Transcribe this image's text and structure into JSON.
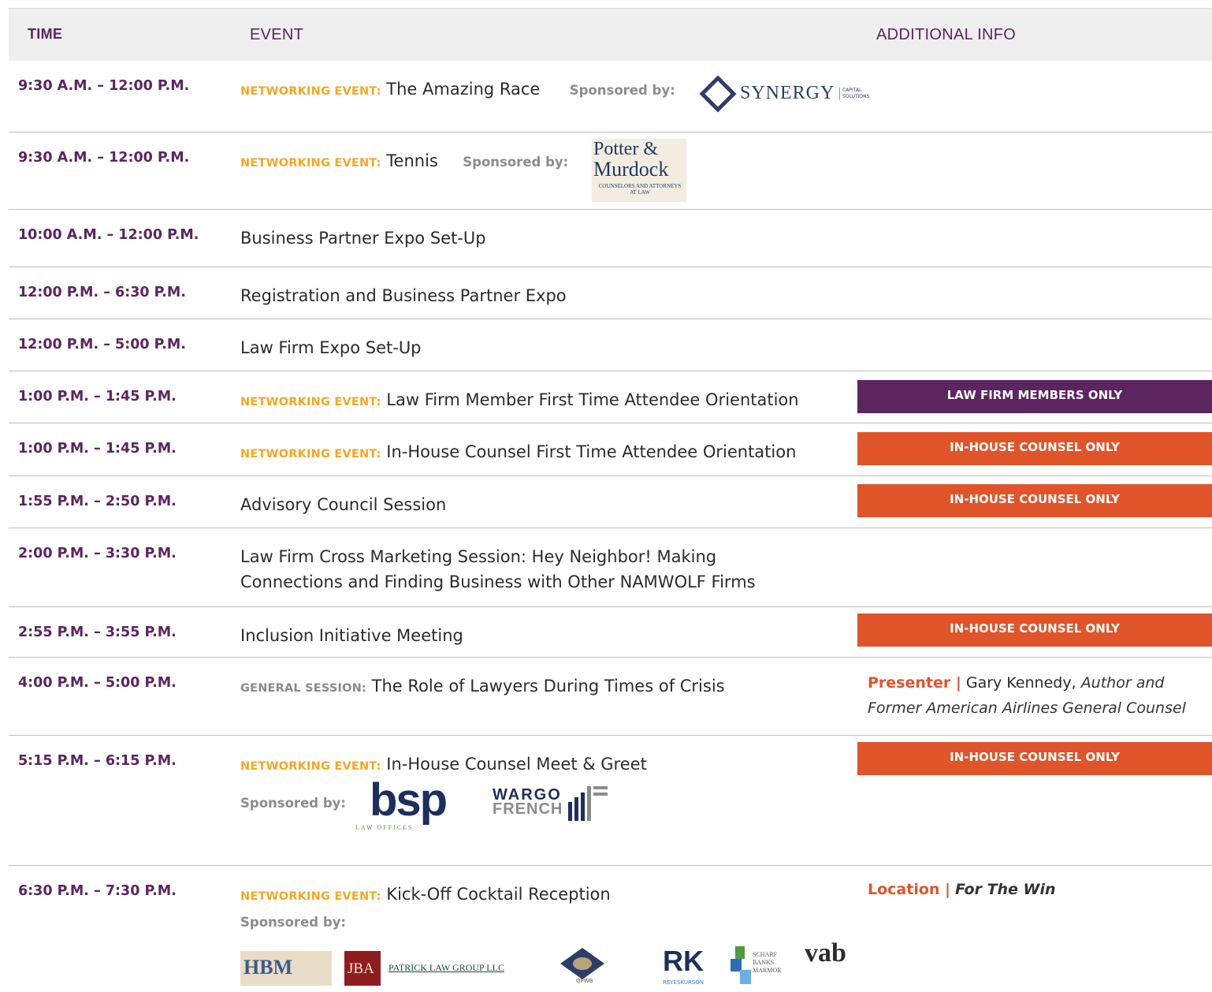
{
  "header": {
    "time": "TIME",
    "event": "EVENT",
    "info": "ADDITIONAL INFO"
  },
  "rows": [
    {
      "time": "9:30 A.M. – 12:00 P.M.",
      "tag": "NETWORKING EVENT:",
      "title": "The Amazing Race",
      "sponsored": "Sponsored by:",
      "logo": "SYNERGY",
      "logo_sub": "CAPITAL SOLUTIONS"
    },
    {
      "time": "9:30 A.M. – 12:00 P.M.",
      "tag": "NETWORKING EVENT:",
      "title": "Tennis",
      "sponsored": "Sponsored by:",
      "logo_l1": "Potter &",
      "logo_l2": "Murdock",
      "logo_sub": "COUNSELORS AND ATTORNEYS AT LAW"
    },
    {
      "time": "10:00 A.M. – 12:00 P.M.",
      "title": "Business Partner Expo Set-Up"
    },
    {
      "time": "12:00 P.M. – 6:30 P.M.",
      "title": "Registration and Business Partner Expo"
    },
    {
      "time": "12:00 P.M. – 5:00 P.M.",
      "title": "Law Firm Expo Set-Up"
    },
    {
      "time": "1:00 P.M. – 1:45 P.M.",
      "tag": "NETWORKING EVENT:",
      "title": "Law Firm Member First Time Attendee Orientation",
      "badge": "LAW FIRM MEMBERS ONLY"
    },
    {
      "time": "1:00 P.M. – 1:45 P.M.",
      "tag": "NETWORKING EVENT:",
      "title": "In-House Counsel First Time Attendee Orientation",
      "badge": "IN-HOUSE COUNSEL ONLY"
    },
    {
      "time": "1:55 P.M. – 2:50 P.M.",
      "title": "Advisory Council Session",
      "badge": "IN-HOUSE COUNSEL ONLY"
    },
    {
      "time": "2:00 P.M. – 3:30 P.M.",
      "title": "Law Firm Cross Marketing Session:  Hey Neighbor!  Making Connections and Finding Business with Other NAMWOLF Firms"
    },
    {
      "time": "2:55 P.M. – 3:55 P.M.",
      "title": "Inclusion Initiative Meeting",
      "badge": "IN-HOUSE COUNSEL ONLY"
    },
    {
      "time": "4:00 P.M. – 5:00 P.M.",
      "tag": "GENERAL SESSION:",
      "title": "The Role of Lawyers During Times of Crisis",
      "info_label": "Presenter |",
      "info_name": "Gary Kennedy,",
      "info_italic": "Author and Former American Airlines General Counsel"
    },
    {
      "time": "5:15 P.M. – 6:15 P.M.",
      "tag": "NETWORKING EVENT:",
      "title": "In-House Counsel Meet & Greet",
      "badge": "IN-HOUSE COUNSEL ONLY",
      "sponsored": "Sponsored by:",
      "logo_bsp": "bsp",
      "logo_bsp_sub": "LAW OFFICES",
      "logo_wf1": "WARGO",
      "logo_wf2": "FRENCH"
    },
    {
      "time": "6:30 P.M. – 7:30 P.M.",
      "tag": "NETWORKING EVENT:",
      "title": "Kick-Off Cocktail Reception",
      "sponsored": "Sponsored by:",
      "info_label": "Location |",
      "info_italic": "For The Win",
      "logos": {
        "hbm": "HBM",
        "jba": "JBA",
        "plg": "PATRICK LAW GROUP LLC",
        "qpwb": "QPWB",
        "rk": "RK",
        "rk_sub": "REYESKURSON",
        "sbm": "SCHARF BANKS MARMOR",
        "vab": "vab"
      }
    }
  ]
}
